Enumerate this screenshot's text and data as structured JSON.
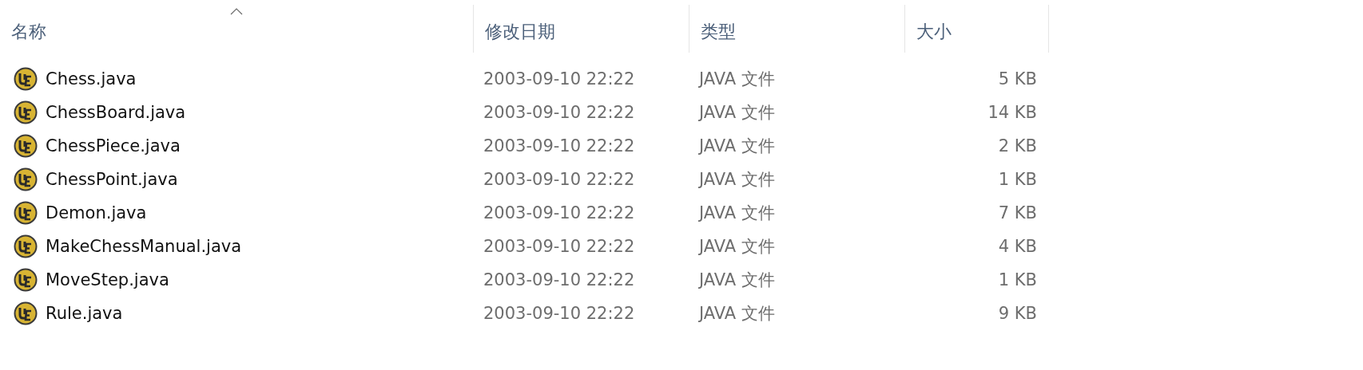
{
  "columns": [
    {
      "label": "名称",
      "sorted": true
    },
    {
      "label": "修改日期",
      "sorted": false
    },
    {
      "label": "类型",
      "sorted": false
    },
    {
      "label": "大小",
      "sorted": false
    }
  ],
  "files": [
    {
      "name": "Chess.java",
      "modified": "2003-09-10 22:22",
      "type": "JAVA 文件",
      "size": "5 KB"
    },
    {
      "name": "ChessBoard.java",
      "modified": "2003-09-10 22:22",
      "type": "JAVA 文件",
      "size": "14 KB"
    },
    {
      "name": "ChessPiece.java",
      "modified": "2003-09-10 22:22",
      "type": "JAVA 文件",
      "size": "2 KB"
    },
    {
      "name": "ChessPoint.java",
      "modified": "2003-09-10 22:22",
      "type": "JAVA 文件",
      "size": "1 KB"
    },
    {
      "name": "Demon.java",
      "modified": "2003-09-10 22:22",
      "type": "JAVA 文件",
      "size": "7 KB"
    },
    {
      "name": "MakeChessManual.java",
      "modified": "2003-09-10 22:22",
      "type": "JAVA 文件",
      "size": "4 KB"
    },
    {
      "name": "MoveStep.java",
      "modified": "2003-09-10 22:22",
      "type": "JAVA 文件",
      "size": "1 KB"
    },
    {
      "name": "Rule.java",
      "modified": "2003-09-10 22:22",
      "type": "JAVA 文件",
      "size": "9 KB"
    }
  ]
}
